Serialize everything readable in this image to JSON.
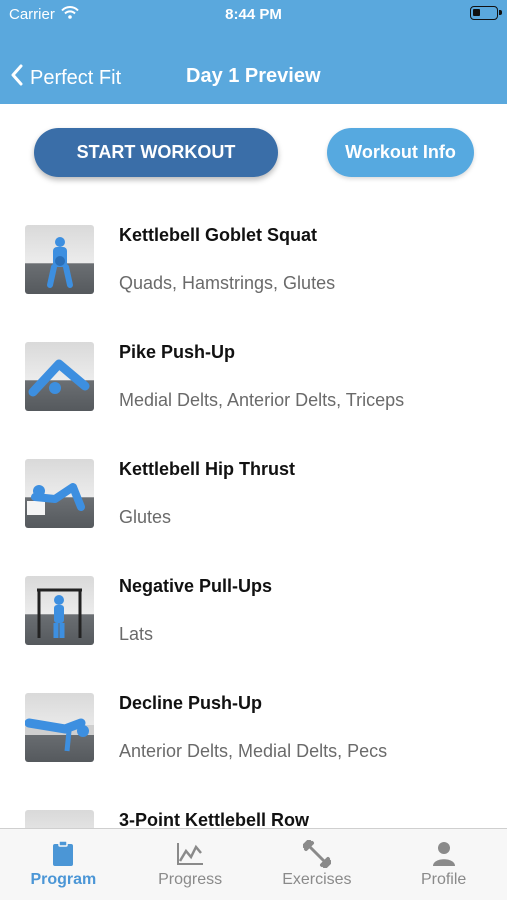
{
  "status": {
    "carrier": "Carrier",
    "time": "8:44 PM"
  },
  "nav": {
    "back_label": "Perfect Fit",
    "title": "Day 1 Preview"
  },
  "actions": {
    "start_label": "START WORKOUT",
    "info_label": "Workout Info"
  },
  "exercises": [
    {
      "name": "Kettlebell Goblet Squat",
      "muscles": "Quads, Hamstrings, Glutes"
    },
    {
      "name": "Pike Push-Up",
      "muscles": "Medial Delts, Anterior Delts, Triceps"
    },
    {
      "name": "Kettlebell Hip Thrust",
      "muscles": "Glutes"
    },
    {
      "name": "Negative Pull-Ups",
      "muscles": "Lats"
    },
    {
      "name": "Decline Push-Up",
      "muscles": "Anterior Delts, Medial Delts, Pecs"
    },
    {
      "name": "3-Point Kettlebell Row",
      "muscles": ""
    }
  ],
  "tabs": [
    {
      "label": "Program",
      "icon": "clipboard-icon",
      "active": true
    },
    {
      "label": "Progress",
      "icon": "chart-icon",
      "active": false
    },
    {
      "label": "Exercises",
      "icon": "dumbbell-icon",
      "active": false
    },
    {
      "label": "Profile",
      "icon": "person-icon",
      "active": false
    }
  ],
  "colors": {
    "header": "#5aa8dd",
    "start_button": "#3a6ea8",
    "info_button": "#56a9e0",
    "tab_active": "#4b96d6",
    "tab_inactive": "#8a8a8a",
    "figure": "#3d8fe0"
  }
}
